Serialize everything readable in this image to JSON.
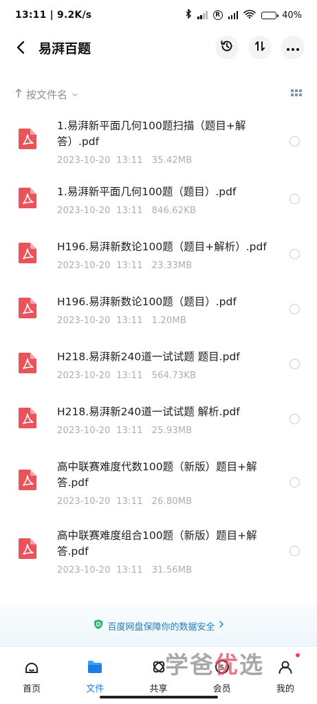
{
  "status_bar": {
    "time_speed": "13:11 | 9.2K/s",
    "battery": "40%",
    "battery_level": 0.4
  },
  "header": {
    "title": "易湃百题",
    "back_icon": "chevron-left-icon",
    "actions": [
      "history-icon",
      "transfer-icon",
      "more-icon"
    ]
  },
  "sort": {
    "label": "按文件名"
  },
  "files": [
    {
      "name": "1.易湃新平面几何100题扫描（题目+解答）.pdf",
      "meta": "2023-10-20  13:11   35.42MB"
    },
    {
      "name": "1.易湃新平面几何100题（题目）.pdf",
      "meta": "2023-10-20  13:11   846.62KB"
    },
    {
      "name": "H196.易湃新数论100题（题目+解析）.pdf",
      "meta": "2023-10-20  13:11   23.33MB"
    },
    {
      "name": "H196.易湃新数论100题（题目）.pdf",
      "meta": "2023-10-20  13:11   1.20MB"
    },
    {
      "name": "H218.易湃新240道一试试题 题目.pdf",
      "meta": "2023-10-20  13:11   564.73KB"
    },
    {
      "name": "H218.易湃新240道一试试题 解析.pdf",
      "meta": "2023-10-20  13:11   25.93MB"
    },
    {
      "name": "高中联赛难度代数100题（新版）题目+解答.pdf",
      "meta": "2023-10-20  13:11   26.80MB"
    },
    {
      "name": "高中联赛难度组合100题（新版）题目+解答.pdf",
      "meta": "2023-10-20  13:11   31.56MB"
    }
  ],
  "banner": {
    "text": "百度网盘保障你的数据安全"
  },
  "tabs": [
    {
      "label": "首页",
      "icon": "home-icon"
    },
    {
      "label": "文件",
      "icon": "folder-icon"
    },
    {
      "label": "共享",
      "icon": "share-icon"
    },
    {
      "label": "会员",
      "icon": "vip-icon"
    },
    {
      "label": "我的",
      "icon": "profile-icon"
    }
  ],
  "watermark": {
    "part1": "学爸",
    "part2": "优",
    "part3": "选"
  },
  "colors": {
    "accent": "#1a7ee6",
    "pdf_red": "#e9545b",
    "meta_gray": "#a9adb5"
  }
}
